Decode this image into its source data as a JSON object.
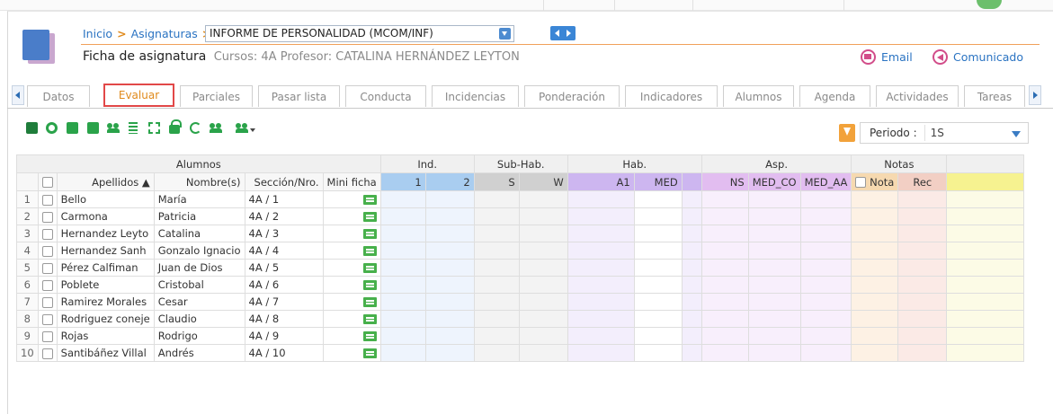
{
  "breadcrumb": {
    "home": "Inicio",
    "section": "Asignaturas",
    "separator": ">",
    "selected_subject": "INFORME DE PERSONALIDAD (MCOM/INF)"
  },
  "header": {
    "title": "Ficha de asignatura",
    "details": "Cursos: 4A Profesor: CATALINA HERNÁNDEZ LEYTON",
    "email_label": "Email",
    "comunicado_label": "Comunicado"
  },
  "tabs": [
    "Datos",
    "Evaluar",
    "Parciales",
    "Pasar lista",
    "Conducta",
    "Incidencias",
    "Ponderación",
    "Indicadores",
    "Alumnos",
    "Agenda",
    "Actividades",
    "Tareas"
  ],
  "active_tab": "Evaluar",
  "periodo": {
    "label": "Periodo :",
    "value": "1S"
  },
  "table": {
    "groups": {
      "alumnos": "Alumnos",
      "ind": "Ind.",
      "subhab": "Sub-Hab.",
      "hab": "Hab.",
      "asp": "Asp.",
      "notas": "Notas"
    },
    "columns": {
      "apellidos": "Apellidos ▲",
      "nombre": "Nombre(s)",
      "seccion": "Sección/Nro.",
      "mini_ficha": "Mini ficha",
      "ind1": "1",
      "ind2": "2",
      "subS": "S",
      "subW": "W",
      "habA1": "A1",
      "habMED": "MED",
      "aspNS": "NS",
      "aspMEDCO": "MED_CO",
      "aspMEDAA": "MED_AA",
      "nota": "Nota",
      "rec": "Rec"
    },
    "rows": [
      {
        "n": "1",
        "apellidos": "Bello",
        "nombre": "María",
        "seccion": "4A / 1"
      },
      {
        "n": "2",
        "apellidos": "Carmona",
        "nombre": "Patricia",
        "seccion": "4A / 2"
      },
      {
        "n": "3",
        "apellidos": "Hernandez Leyto",
        "nombre": "Catalina",
        "seccion": "4A / 3"
      },
      {
        "n": "4",
        "apellidos": "Hernandez Sanh",
        "nombre": "Gonzalo Ignacio",
        "seccion": "4A / 4"
      },
      {
        "n": "5",
        "apellidos": "Pérez Calfiman",
        "nombre": "Juan de Dios",
        "seccion": "4A / 5"
      },
      {
        "n": "6",
        "apellidos": "Poblete",
        "nombre": "Cristobal",
        "seccion": "4A / 6"
      },
      {
        "n": "7",
        "apellidos": "Ramirez Morales",
        "nombre": "Cesar",
        "seccion": "4A / 7"
      },
      {
        "n": "8",
        "apellidos": "Rodriguez coneje",
        "nombre": "Claudio",
        "seccion": "4A / 8"
      },
      {
        "n": "9",
        "apellidos": "Rojas",
        "nombre": "Rodrigo",
        "seccion": "4A / 9"
      },
      {
        "n": "10",
        "apellidos": "Santibáñez Villal",
        "nombre": "Andrés",
        "seccion": "4A / 10"
      }
    ]
  },
  "colors": {
    "accent_blue": "#2a73c2",
    "accent_orange": "#e08a1c",
    "active_tab_border": "#e24848",
    "ind_header": "#a9cdf0",
    "sub_header": "#d0d0d0",
    "hab_header": "#cdb6f0",
    "asp_header": "#e2bdf0",
    "notas_header": "#f6d9b0",
    "rec_header": "#f2cfc4",
    "extra_header": "#f6f290"
  },
  "icons": [
    "save-icon",
    "settings-icon",
    "export-icon",
    "import-icon",
    "users-icon",
    "calculator-icon",
    "expand-icon",
    "lock-icon",
    "refresh-icon",
    "search-user-icon",
    "user-menu-icon"
  ]
}
